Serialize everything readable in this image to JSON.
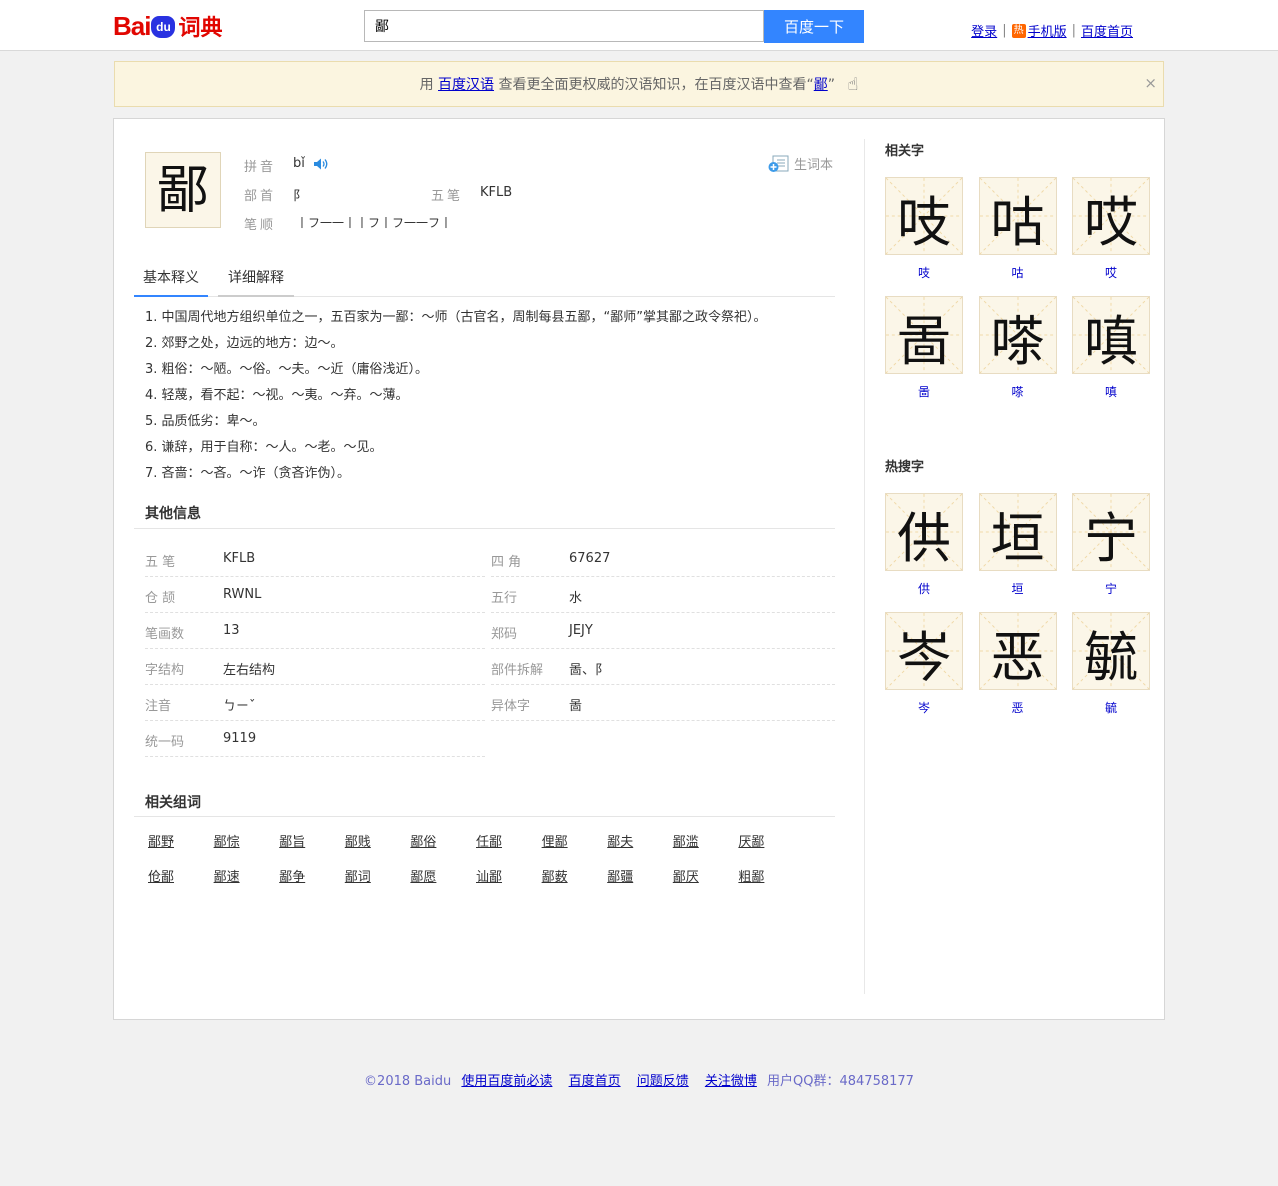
{
  "header": {
    "logo": {
      "bai": "Bai",
      "du": "du",
      "product": "词典"
    },
    "search_value": "鄙",
    "search_button": "百度一下",
    "links": {
      "login": "登录",
      "hot_badge": "热",
      "mobile": "手机版",
      "home": "百度首页"
    }
  },
  "notice": {
    "prefix": "用",
    "link": "百度汉语",
    "middle": "查看更全面更权威的汉语知识，在百度汉语中查看",
    "open_quote": "“",
    "char_link": "鄙",
    "close_quote": "”",
    "close": "×"
  },
  "entry": {
    "char": "鄙",
    "pinyin_label": "拼音",
    "pinyin": "bǐ",
    "radical_label": "部首",
    "radical": "阝",
    "wubi_label": "五笔",
    "wubi": "KFLB",
    "strokes_label": "笔顺",
    "strokes": "丨フ一一丨丨フ丨フ一一フ丨",
    "vocab_button": "生词本"
  },
  "tabs": {
    "basic": "基本释义",
    "detail": "详细解释"
  },
  "definitions": [
    "1. 中国周代地方组织单位之一，五百家为一鄙：～师（古官名，周制每县五鄙，“鄙师”掌其鄙之政令祭祀）。",
    "2. 郊野之处，边远的地方：边～。",
    "3. 粗俗：～陋。～俗。～夫。～近（庸俗浅近）。",
    "4. 轻蔑，看不起：～视。～夷。～弃。～薄。",
    "5. 品质低劣：卑～。",
    "6. 谦辞，用于自称：～人。～老。～见。",
    "7. 吝啬：～吝。～诈（贪吝诈伪）。"
  ],
  "other_info": {
    "title": "其他信息",
    "rows": [
      [
        {
          "k": "五 笔",
          "v": "KFLB"
        },
        {
          "k": "四 角",
          "v": "67627"
        }
      ],
      [
        {
          "k": "仓 颉",
          "v": "RWNL"
        },
        {
          "k": "五行",
          "v": "水"
        }
      ],
      [
        {
          "k": "笔画数",
          "v": "13"
        },
        {
          "k": "郑码",
          "v": "JEJY"
        }
      ],
      [
        {
          "k": "字结构",
          "v": "左右结构"
        },
        {
          "k": "部件拆解",
          "v": "啚、阝"
        }
      ],
      [
        {
          "k": "注音",
          "v": "ㄅㄧˇ"
        },
        {
          "k": "异体字",
          "v": "啚"
        }
      ],
      [
        {
          "k": "统一码",
          "v": "9119"
        }
      ]
    ]
  },
  "related_words": {
    "title": "相关组词",
    "words": [
      "鄙野",
      "鄙悰",
      "鄙旨",
      "鄙贱",
      "鄙俗",
      "任鄙",
      "俚鄙",
      "鄙夫",
      "鄙滥",
      "厌鄙",
      "伧鄙",
      "鄙速",
      "鄙争",
      "鄙词",
      "鄙愿",
      "讪鄙",
      "鄙薮",
      "鄙疆",
      "鄙厌",
      "粗鄙"
    ]
  },
  "related_chars": {
    "title": "相关字",
    "chars": [
      "吱",
      "咕",
      "哎",
      "啚",
      "嗏",
      "嗔"
    ]
  },
  "hot_chars": {
    "title": "热搜字",
    "chars": [
      "供",
      "垣",
      "宁",
      "岑",
      "恶",
      "毓"
    ]
  },
  "footer": {
    "copyright": "©2018 Baidu",
    "links": [
      "使用百度前必读",
      "百度首页",
      "问题反馈",
      "关注微博"
    ],
    "qq": "用户QQ群：484758177"
  }
}
